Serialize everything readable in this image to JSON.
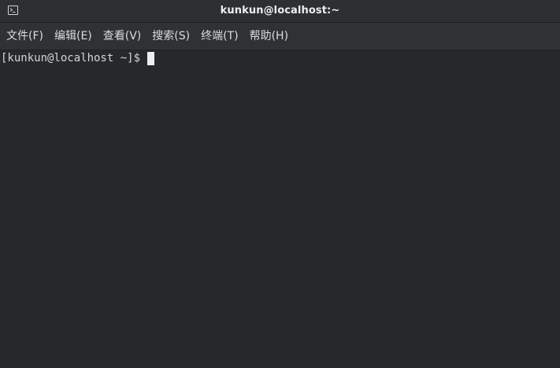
{
  "window": {
    "title": "kunkun@localhost:~"
  },
  "titlebar": {
    "icon": "terminal-icon"
  },
  "menu": {
    "items": [
      {
        "label": "文件(F)"
      },
      {
        "label": "编辑(E)"
      },
      {
        "label": "查看(V)"
      },
      {
        "label": "搜索(S)"
      },
      {
        "label": "终端(T)"
      },
      {
        "label": "帮助(H)"
      }
    ]
  },
  "terminal": {
    "prompt": "[kunkun@localhost ~]$"
  },
  "colors": {
    "background": "#25292c",
    "titlebar": "#2c3033",
    "menubar": "#2e3235",
    "text": "#d3d7cf",
    "cursor": "#eeeeec"
  }
}
